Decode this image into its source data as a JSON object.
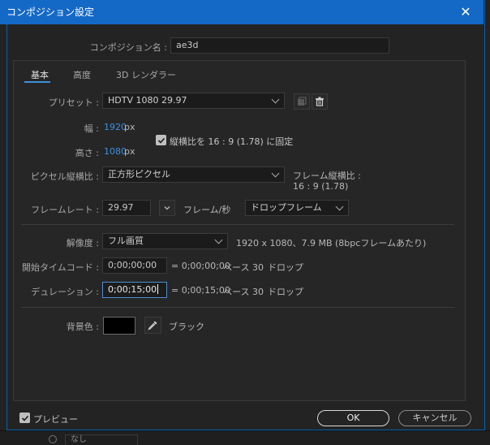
{
  "window": {
    "title": "コンポジション設定",
    "close_glyph": "✕"
  },
  "comp_name": {
    "label": "コンポジション名 :",
    "value": "ae3d"
  },
  "tabs": [
    {
      "label": "基本"
    },
    {
      "label": "高度"
    },
    {
      "label": "3D レンダラー"
    }
  ],
  "preset": {
    "label": "プリセット :",
    "value": "HDTV 1080 29.97"
  },
  "width": {
    "label": "幅 :",
    "value": "1920",
    "unit": "px"
  },
  "height": {
    "label": "高さ :",
    "value": "1080",
    "unit": "px"
  },
  "lock_aspect": {
    "label": "縦横比を 16 : 9 (1.78) に固定",
    "checked": true
  },
  "pixel_aspect": {
    "label": "ピクセル縦横比 :",
    "value": "正方形ピクセル"
  },
  "frame_aspect": {
    "label": "フレーム縦横比 :",
    "value": "16 : 9 (1.78)"
  },
  "frame_rate": {
    "label": "フレームレート :",
    "value": "29.97",
    "unit": "フレーム/秒",
    "mode": "ドロップフレーム"
  },
  "resolution": {
    "label": "解像度 :",
    "value": "フル画質",
    "info": "1920 x 1080、7.9 MB (8bpcフレームあたり)"
  },
  "start_timecode": {
    "label": "開始タイムコード :",
    "value": "0;00;00;00",
    "equals": "= 0;00;00;00",
    "base": "ベース 30",
    "drop": "ドロップ"
  },
  "duration": {
    "label": "デュレーション :",
    "value": "0;00;15;00",
    "equals": "= 0;00;15;00",
    "base": "ベース 30",
    "drop": "ドロップ"
  },
  "background": {
    "label": "背景色 :",
    "color": "#000000",
    "name": "ブラック"
  },
  "preview": {
    "label": "プレビュー",
    "checked": true
  },
  "buttons": {
    "ok": "OK",
    "cancel": "キャンセル"
  },
  "background_app": {
    "select_value": "なし"
  },
  "colors": {
    "title_bar": "#1469c7",
    "accent_blue": "#3f8fdc"
  }
}
